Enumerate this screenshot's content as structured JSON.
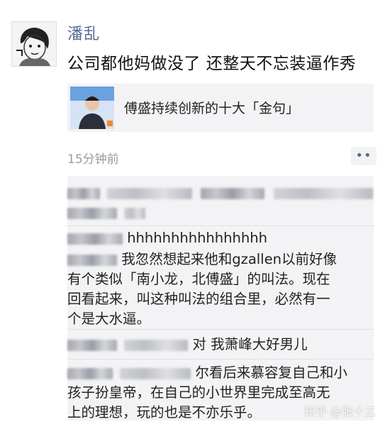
{
  "post": {
    "author": "潘乱",
    "text": "公司都他妈做没了 还整天不忘装逼作秀",
    "time": "15分钟前",
    "more_label": "••"
  },
  "link_card": {
    "title": "傅盛持续创新的十大「金句」"
  },
  "comments": [
    {
      "text": ""
    },
    {
      "text": "hhhhhhhhhhhhhhhh"
    },
    {
      "text": "我忽然想起来他和gzallen以前好像\n有个类似「南小龙，北傅盛」的叫法。现在\n回看起来，叫这种叫法的组合里，必然有一\n个是大水逼。"
    },
    {
      "text": "对 我萧峰大好男儿"
    },
    {
      "text": "尔看后来慕容复自己和小\n孩子扮皇帝，在自己的小世界里完成至高无\n上的理想，玩的也是不亦乐乎。"
    }
  ],
  "watermark": "知乎 @张十三",
  "colors": {
    "name": "#576b95",
    "bg_card": "#f3f3f5",
    "time": "#9a9a9a"
  }
}
